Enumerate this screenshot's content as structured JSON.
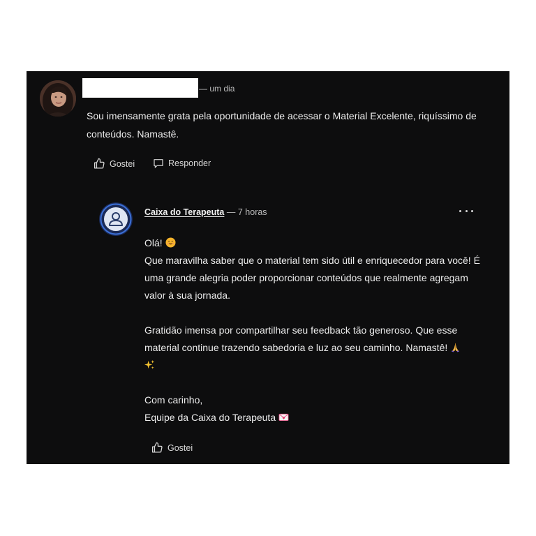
{
  "comment": {
    "time": "um dia",
    "text": "Sou imensamente grata pela oportunidade de acessar o Material Excelente, riquíssimo de conteúdos. Namastê.",
    "like_label": "Gostei",
    "reply_label": "Responder"
  },
  "reply": {
    "author": "Caixa do Terapeuta",
    "time": "7 horas",
    "greeting": "Olá!",
    "paragraph1": "Que maravilha saber que o material tem sido útil e enriquecedor para você! É uma grande alegria poder proporcionar conteúdos que realmente agregam valor à sua jornada.",
    "paragraph2": "Gratidão imensa por compartilhar seu feedback tão generoso. Que esse material continue trazendo sabedoria e luz ao seu caminho. Namastê!",
    "signoff": "Com carinho,",
    "signature": "Equipe da Caixa do Terapeuta",
    "like_label": "Gostei"
  },
  "icons": {
    "like": "thumbs-up-icon",
    "reply": "speech-bubble-icon",
    "more": "more-options-icon",
    "emoji_smile": "smiling-face-icon",
    "emoji_pray": "folded-hands-icon",
    "emoji_sparkles": "sparkles-icon",
    "emoji_heart": "love-letter-icon"
  },
  "colors": {
    "background": "#0d0d0e",
    "text": "#ececec",
    "muted": "#bdbdbd",
    "brand_blue": "#3b6fd6"
  }
}
